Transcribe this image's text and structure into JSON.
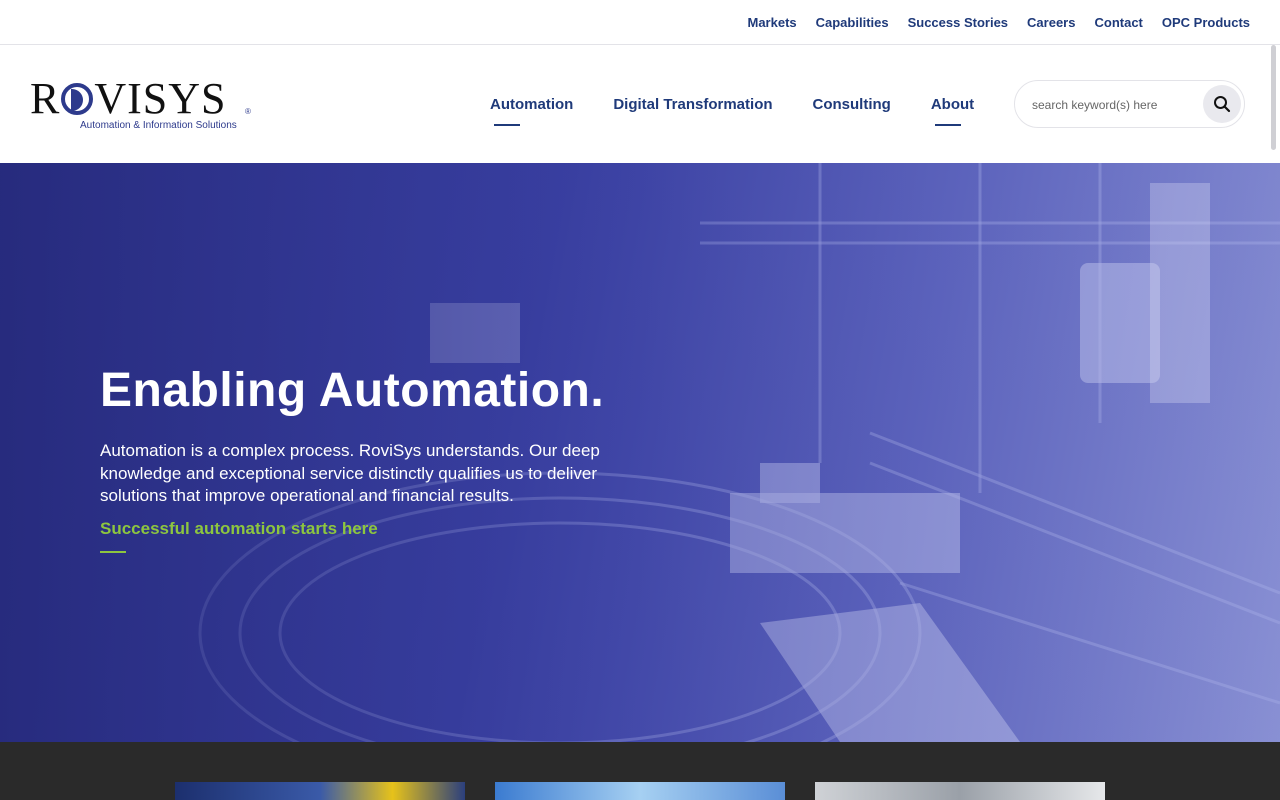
{
  "utility_nav": [
    "Markets",
    "Capabilities",
    "Success Stories",
    "Careers",
    "Contact",
    "OPC Products"
  ],
  "logo": {
    "wordmark_pre": "R",
    "wordmark_post": "VISYS",
    "tagline": "Automation & Information Solutions",
    "reg": "®"
  },
  "main_nav": [
    {
      "label": "Automation",
      "active": true
    },
    {
      "label": "Digital Transformation",
      "active": false
    },
    {
      "label": "Consulting",
      "active": false
    },
    {
      "label": "About",
      "active": true
    }
  ],
  "search": {
    "placeholder": "search keyword(s) here",
    "icon": "search-icon"
  },
  "hero": {
    "title": "Enabling Automation.",
    "body": "Automation is a complex process. RoviSys understands. Our deep knowledge and exceptional service distinctly qualifies us to deliver solutions that improve operational and financial results.",
    "cta": "Successful automation starts here"
  },
  "colors": {
    "brand_blue": "#1f3a7a",
    "accent_green": "#8dc63f",
    "hero_overlay": "#2a2f85",
    "footer_dark": "#2a2a2a"
  }
}
